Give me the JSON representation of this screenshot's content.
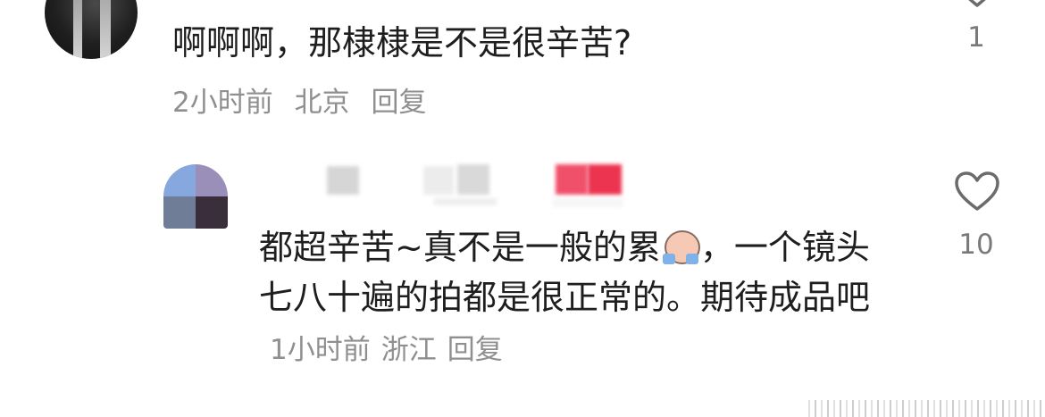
{
  "comment": {
    "text": "啊啊啊，那棣棣是不是很辛苦?",
    "time": "2小时前",
    "location": "北京",
    "reply_label": "回复",
    "like_count": "1"
  },
  "reply": {
    "text_before_emoji": "都超辛苦~真不是一般的累",
    "text_after_emoji": "，一个镜头七八十遍的拍都是很正常的。期待成品吧",
    "time": "1小时前",
    "location": "浙江",
    "reply_label": "回复",
    "like_count": "10",
    "emoji_icon": "crying-face-emoji"
  },
  "colors": {
    "text": "#1e1e1e",
    "meta": "#8f8f8f",
    "like_count": "#7a7a7a",
    "heart_stroke": "#6b6b6b"
  }
}
